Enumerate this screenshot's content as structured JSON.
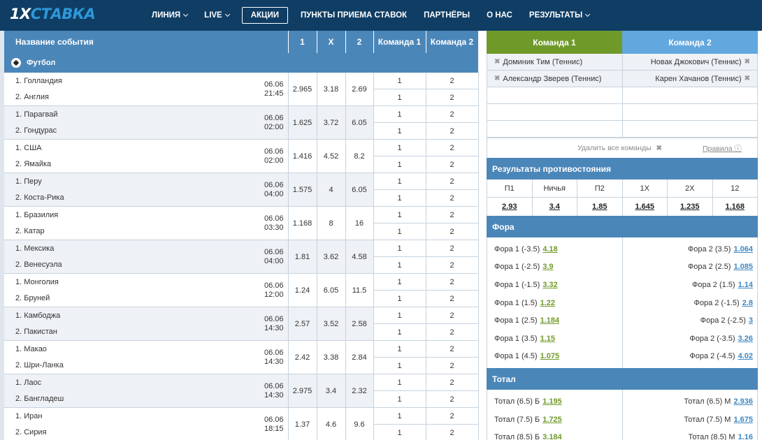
{
  "header": {
    "logo_prefix": "1X",
    "logo_suffix": "СТАВКА",
    "nav": [
      {
        "label": "ЛИНИЯ",
        "dropdown": true
      },
      {
        "label": "LIVE",
        "dropdown": true
      },
      {
        "label": "АКЦИИ",
        "active": true
      },
      {
        "label": "ПУНКТЫ ПРИЕМА СТАВОК"
      },
      {
        "label": "ПАРТНЁРЫ"
      },
      {
        "label": "О НАС"
      },
      {
        "label": "РЕЗУЛЬТАТЫ",
        "dropdown": true
      }
    ]
  },
  "table": {
    "headers": [
      "Название события",
      "1",
      "X",
      "2",
      "Команда 1",
      "Команда 2"
    ],
    "sport": "Футбол",
    "events": [
      {
        "team1": "1. Голландия",
        "team2": "2. Англия",
        "date": "06.06",
        "time": "21:45",
        "o1": "2.965",
        "ox": "3.18",
        "o2": "2.69"
      },
      {
        "team1": "1. Парагвай",
        "team2": "2. Гондурас",
        "date": "06.06",
        "time": "02:00",
        "o1": "1.625",
        "ox": "3.72",
        "o2": "6.05"
      },
      {
        "team1": "1. США",
        "team2": "2. Ямайка",
        "date": "06.06",
        "time": "02:00",
        "o1": "1.416",
        "ox": "4.52",
        "o2": "8.2"
      },
      {
        "team1": "1. Перу",
        "team2": "2. Коста-Рика",
        "date": "06.06",
        "time": "04:00",
        "o1": "1.575",
        "ox": "4",
        "o2": "6.05"
      },
      {
        "team1": "1. Бразилия",
        "team2": "2. Катар",
        "date": "06.06",
        "time": "03:30",
        "o1": "1.168",
        "ox": "8",
        "o2": "16"
      },
      {
        "team1": "1. Мексика",
        "team2": "2. Венесуэла",
        "date": "06.06",
        "time": "04:00",
        "o1": "1.81",
        "ox": "3.62",
        "o2": "4.58"
      },
      {
        "team1": "1. Монголия",
        "team2": "2. Бруней",
        "date": "06.06",
        "time": "12:00",
        "o1": "1.24",
        "ox": "6.05",
        "o2": "11.5"
      },
      {
        "team1": "1. Камбоджа",
        "team2": "2. Пакистан",
        "date": "06.06",
        "time": "14:30",
        "o1": "2.57",
        "ox": "3.52",
        "o2": "2.58"
      },
      {
        "team1": "1. Макао",
        "team2": "2. Шри-Ланка",
        "date": "06.06",
        "time": "14:30",
        "o1": "2.42",
        "ox": "3.38",
        "o2": "2.84"
      },
      {
        "team1": "1. Лаос",
        "team2": "2. Бангладеш",
        "date": "06.06",
        "time": "14:30",
        "o1": "2.975",
        "ox": "3.4",
        "o2": "2.32"
      },
      {
        "team1": "1. Иран",
        "team2": "2. Сирия",
        "date": "06.06",
        "time": "18:15",
        "o1": "1.37",
        "ox": "4.6",
        "o2": "9.6"
      }
    ],
    "pick1": "1",
    "pick2": "2"
  },
  "panel": {
    "tab1": "Команда 1",
    "tab2": "Команда 2",
    "pairs": [
      {
        "left": "Доминик Тим (Теннис)",
        "right": "Новак Джокович (Теннис)"
      },
      {
        "left": "Александр Зверев (Теннис)",
        "right": "Карен Хачанов (Теннис)"
      }
    ],
    "delete_all": "Удалить все команды",
    "rules": "Правила",
    "results_title": "Результаты противостояния",
    "results": [
      {
        "h": "П1",
        "v": "2.93"
      },
      {
        "h": "Ничья",
        "v": "3.4"
      },
      {
        "h": "П2",
        "v": "1.85"
      },
      {
        "h": "1Х",
        "v": "1.645"
      },
      {
        "h": "2Х",
        "v": "1.235"
      },
      {
        "h": "12",
        "v": "1.168"
      }
    ],
    "fora_title": "Фора",
    "fora_left": [
      {
        "l": "Фора 1 (-3.5)",
        "v": "4.18"
      },
      {
        "l": "Фора 1 (-2.5)",
        "v": "3.9"
      },
      {
        "l": "Фора 1 (-1.5)",
        "v": "3.32"
      },
      {
        "l": "Фора 1 (1.5)",
        "v": "1.22"
      },
      {
        "l": "Фора 1 (2.5)",
        "v": "1.184"
      },
      {
        "l": "Фора 1 (3.5)",
        "v": "1.15"
      },
      {
        "l": "Фора 1 (4.5)",
        "v": "1.075"
      }
    ],
    "fora_right": [
      {
        "l": "Фора 2 (3.5)",
        "v": "1.064"
      },
      {
        "l": "Фора 2 (2.5)",
        "v": "1.085"
      },
      {
        "l": "Фора 2 (1.5)",
        "v": "1.14"
      },
      {
        "l": "Фора 2 (-1.5)",
        "v": "2.8"
      },
      {
        "l": "Фора 2 (-2.5)",
        "v": "3"
      },
      {
        "l": "Фора 2 (-3.5)",
        "v": "3.26"
      },
      {
        "l": "Фора 2 (-4.5)",
        "v": "4.02"
      }
    ],
    "total_title": "Тотал",
    "total_left": [
      {
        "l": "Тотал (6.5) Б",
        "v": "1.195"
      },
      {
        "l": "Тотал (7.5) Б",
        "v": "1.725"
      },
      {
        "l": "Тотал (8.5) Б",
        "v": "3.184"
      }
    ],
    "total_right": [
      {
        "l": "Тотал (6.5) М",
        "v": "2.936"
      },
      {
        "l": "Тотал (7.5) М",
        "v": "1.675"
      },
      {
        "l": "Тотал (8.5) М",
        "v": "1.16"
      }
    ]
  }
}
